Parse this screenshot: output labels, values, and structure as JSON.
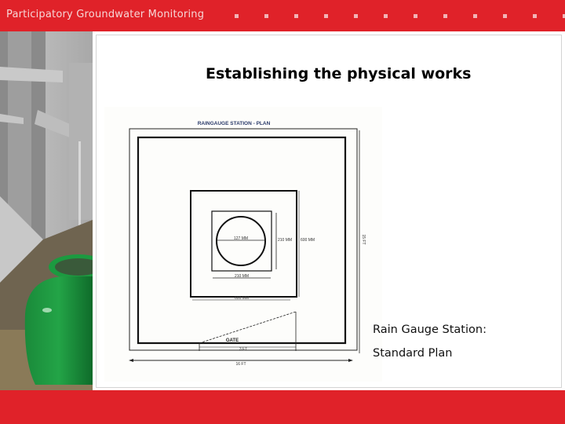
{
  "header": {
    "title": "Participatory Groundwater Monitoring",
    "background_color": "#e02229",
    "dot_count": 12
  },
  "slide": {
    "title": "Establishing the physical works",
    "photo_description": "hand pump pouring water into green pot"
  },
  "drawing": {
    "title": "RAINGAUGE STATION - PLAN",
    "labels": {
      "circle_diameter": "127 MM",
      "inner_square_side": "210 MM",
      "inner_square_height": "210 MM",
      "outer_square_width": "600 MM",
      "outer_square_height": "600 MM",
      "enclosure_height": "15 FT",
      "enclosure_width": "16 FT",
      "gate": "GATE",
      "gate_width": "3 FT"
    }
  },
  "caption": {
    "line1": "Rain Gauge Station:",
    "line2": "Standard Plan"
  },
  "footer": {
    "background_color": "#e02229"
  }
}
